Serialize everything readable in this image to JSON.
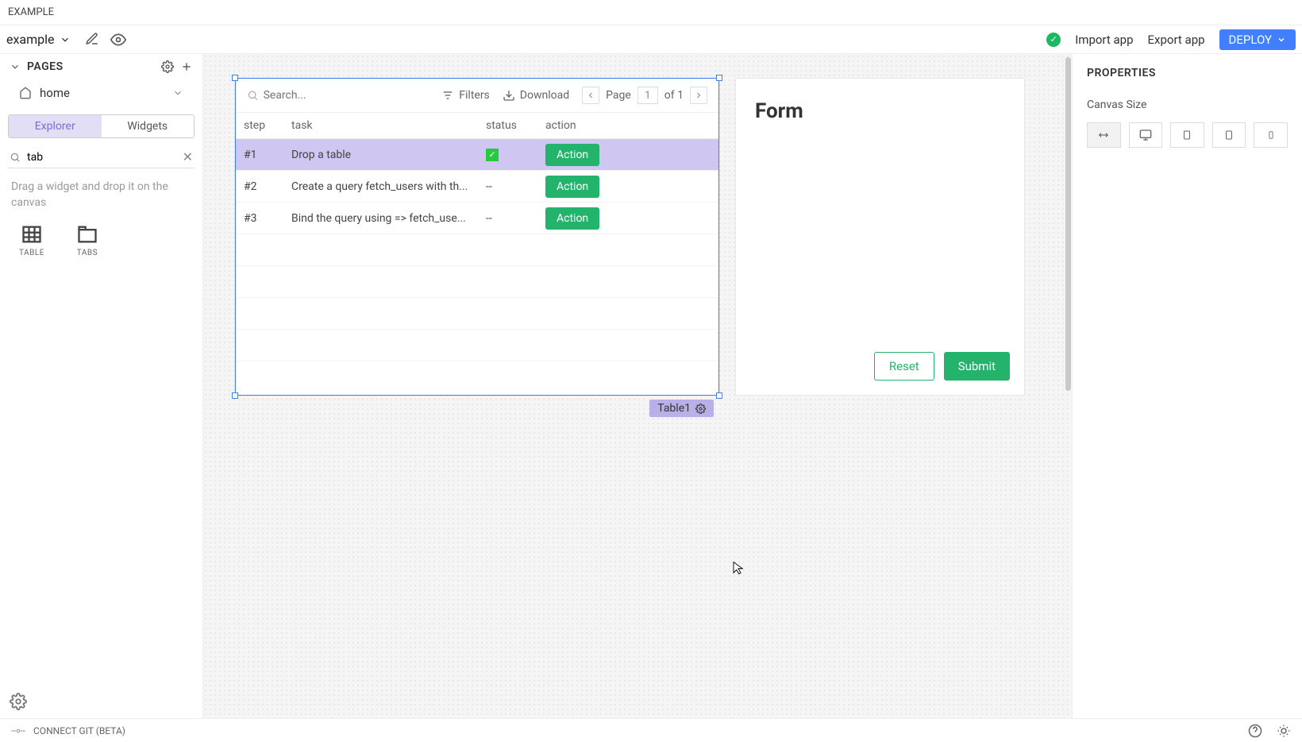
{
  "titlebar": {
    "name": "EXAMPLE"
  },
  "appbar": {
    "appname": "example",
    "import": "Import app",
    "export": "Export app",
    "deploy": "DEPLOY"
  },
  "sidebar": {
    "pages_label": "PAGES",
    "page_home": "home",
    "tabs": {
      "explorer": "Explorer",
      "widgets": "Widgets"
    },
    "search_value": "tab",
    "hint": "Drag a widget and drop it on the canvas",
    "widgets": [
      {
        "label": "TABLE"
      },
      {
        "label": "TABS"
      }
    ]
  },
  "table": {
    "search_placeholder": "Search...",
    "filters": "Filters",
    "download": "Download",
    "page_label": "Page",
    "page_num": "1",
    "page_of": "of 1",
    "columns": {
      "step": "step",
      "task": "task",
      "status": "status",
      "action": "action"
    },
    "rows": [
      {
        "step": "#1",
        "task": "Drop a table",
        "status": "done",
        "action": "Action"
      },
      {
        "step": "#2",
        "task": "Create a query fetch_users with th...",
        "status": "--",
        "action": "Action"
      },
      {
        "step": "#3",
        "task": "Bind the query using => fetch_use...",
        "status": "--",
        "action": "Action"
      }
    ],
    "widget_label": "Table1"
  },
  "form": {
    "title": "Form",
    "reset": "Reset",
    "submit": "Submit"
  },
  "properties": {
    "title": "PROPERTIES",
    "canvas_size": "Canvas Size"
  },
  "footer": {
    "git": "CONNECT GIT (BETA)"
  }
}
